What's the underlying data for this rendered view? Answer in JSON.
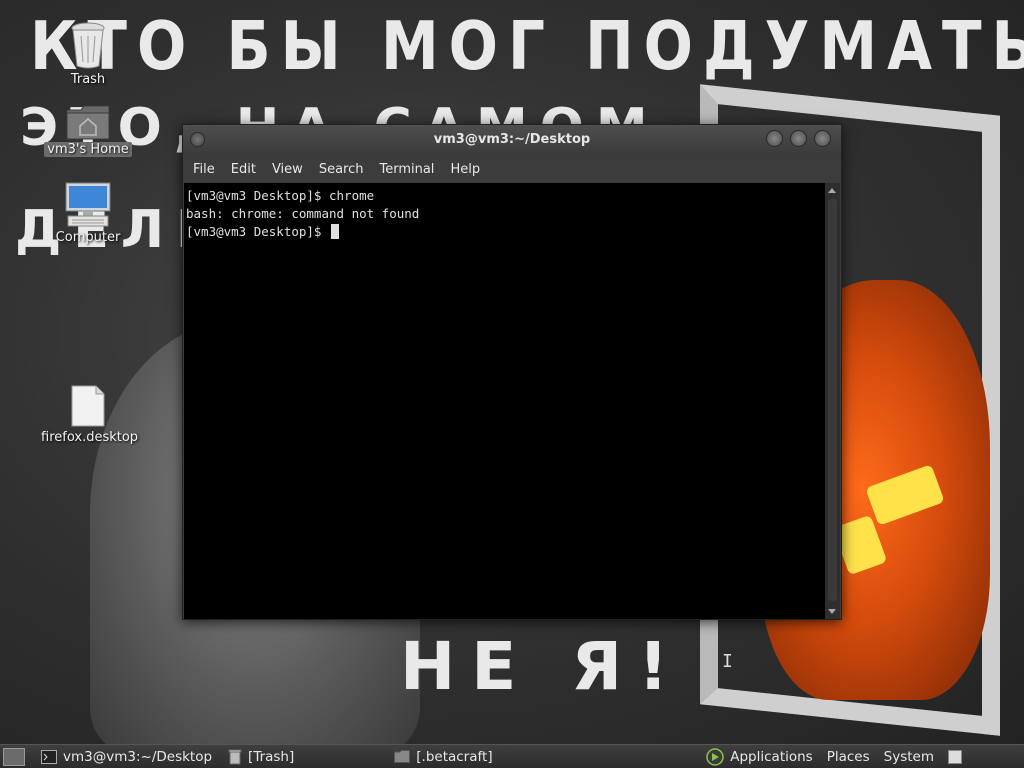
{
  "wallpaper": {
    "line1": "КТО БЫ МОГ ПОДУМАТЬ, ЧТО Я –",
    "line2": "ЭТО, НА САМОМ",
    "line3": "ДЕЛЕ,",
    "line4": "НЕ Я!"
  },
  "desktop_icons": {
    "trash": "Trash",
    "home": "vm3's Home",
    "computer": "Computer",
    "firefox": "firefox.desktop"
  },
  "terminal": {
    "title": "vm3@vm3:~/Desktop",
    "menu": [
      "File",
      "Edit",
      "View",
      "Search",
      "Terminal",
      "Help"
    ],
    "lines": [
      "[vm3@vm3 Desktop]$ chrome",
      "bash: chrome: command not found",
      "[vm3@vm3 Desktop]$ "
    ]
  },
  "taskbar": {
    "tasks": [
      "vm3@vm3:~/Desktop",
      "[Trash]",
      "[.betacraft]"
    ],
    "applications": "Applications",
    "places": "Places",
    "system": "System"
  },
  "icons": {
    "trash": "trash-icon",
    "home": "home-folder-icon",
    "computer": "computer-icon",
    "file": "file-icon",
    "terminal": "terminal-icon",
    "folder": "folder-icon",
    "apps": "applications-icon"
  }
}
